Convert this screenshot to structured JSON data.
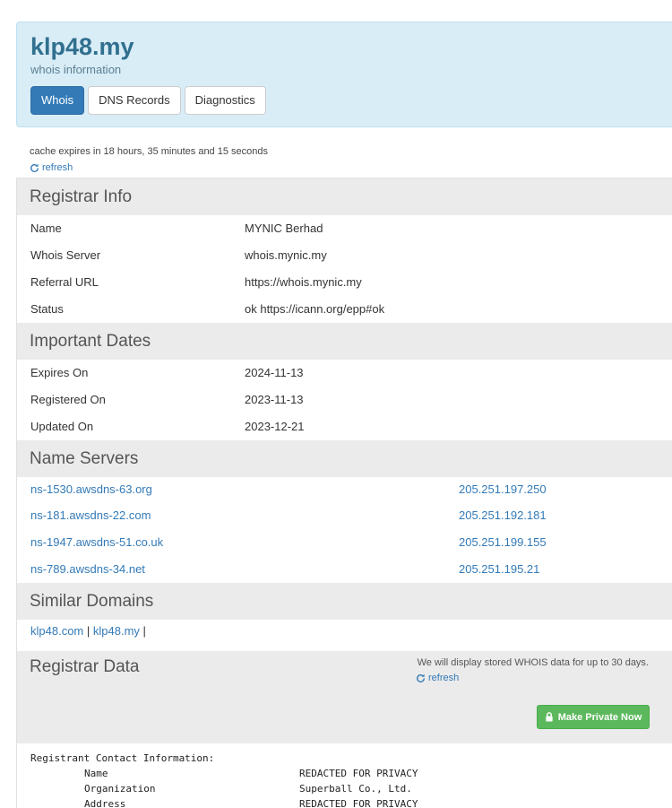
{
  "header": {
    "domain": "klp48.my",
    "subtitle": "whois information",
    "tabs": [
      {
        "label": "Whois",
        "active": true
      },
      {
        "label": "DNS Records",
        "active": false
      },
      {
        "label": "Diagnostics",
        "active": false
      }
    ]
  },
  "cache": {
    "text": "cache expires in 18 hours, 35 minutes and 15 seconds",
    "refresh_label": "refresh"
  },
  "registrar_info": {
    "title": "Registrar Info",
    "rows": [
      {
        "key": "Name",
        "value": "MYNIC Berhad"
      },
      {
        "key": "Whois Server",
        "value": "whois.mynic.my"
      },
      {
        "key": "Referral URL",
        "value": "https://whois.mynic.my"
      },
      {
        "key": "Status",
        "value": "ok https://icann.org/epp#ok"
      }
    ]
  },
  "important_dates": {
    "title": "Important Dates",
    "rows": [
      {
        "key": "Expires On",
        "value": "2024-11-13"
      },
      {
        "key": "Registered On",
        "value": "2023-11-13"
      },
      {
        "key": "Updated On",
        "value": "2023-12-21"
      }
    ]
  },
  "name_servers": {
    "title": "Name Servers",
    "rows": [
      {
        "name": "ns-1530.awsdns-63.org",
        "ip": "205.251.197.250"
      },
      {
        "name": "ns-181.awsdns-22.com",
        "ip": "205.251.192.181"
      },
      {
        "name": "ns-1947.awsdns-51.co.uk",
        "ip": "205.251.199.155"
      },
      {
        "name": "ns-789.awsdns-34.net",
        "ip": "205.251.195.21"
      }
    ]
  },
  "similar_domains": {
    "title": "Similar Domains",
    "items": [
      "klp48.com",
      "klp48.my"
    ],
    "separator": "|"
  },
  "registrar_data": {
    "title": "Registrar Data",
    "note": "We will display stored WHOIS data for up to 30 days.",
    "refresh_label": "refresh",
    "private_button": "Make Private Now",
    "raw_heading": "Registrant Contact Information:",
    "raw_rows": [
      {
        "key": "Name",
        "value": "REDACTED FOR PRIVACY"
      },
      {
        "key": "Organization",
        "value": "Superball Co., Ltd."
      },
      {
        "key": "Address",
        "value": "REDACTED FOR PRIVACY"
      }
    ]
  },
  "colors": {
    "header_bg": "#d9edf7",
    "accent": "#337ab7",
    "section_bg": "#ebebeb",
    "success": "#5cb85c"
  }
}
